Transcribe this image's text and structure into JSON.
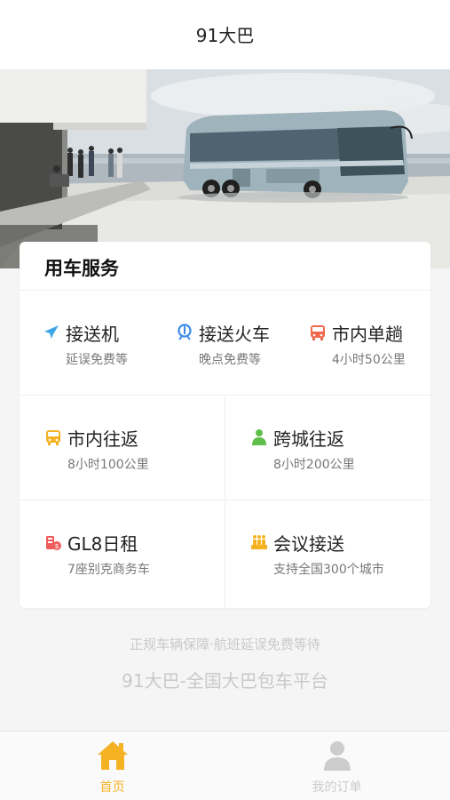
{
  "app": {
    "title": "91大巴"
  },
  "service_card": {
    "title": "用车服务",
    "items": [
      {
        "name": "接送机",
        "sub": "延误免费等",
        "icon": "airplane-icon",
        "color": "#3aa6e8"
      },
      {
        "name": "接送火车",
        "sub": "晚点免费等",
        "icon": "train-icon",
        "color": "#3a8be8"
      },
      {
        "name": "市内单趟",
        "sub": "4小时50公里",
        "icon": "bus-icon",
        "color": "#f0674c"
      },
      {
        "name": "市内往返",
        "sub": "8小时100公里",
        "icon": "bus-icon",
        "color": "#f5b324"
      },
      {
        "name": "跨城往返",
        "sub": "8小时200公里",
        "icon": "person-icon",
        "color": "#5fbf4a"
      },
      {
        "name": "GL8日租",
        "sub": "7座别克商务车",
        "icon": "car-rental-icon",
        "color": "#ef5a5a"
      },
      {
        "name": "会议接送",
        "sub": "支持全国300个城市",
        "icon": "meeting-icon",
        "color": "#f5b324"
      }
    ]
  },
  "footer": {
    "note": "正规车辆保障·航班延误免费等待",
    "slogan": "91大巴-全国大巴包车平台"
  },
  "tabbar": {
    "items": [
      {
        "label": "首页",
        "icon": "home-icon",
        "active": true,
        "color": "#f5b324"
      },
      {
        "label": "我的订单",
        "icon": "user-icon",
        "active": false,
        "color": "#cccccc"
      }
    ]
  }
}
